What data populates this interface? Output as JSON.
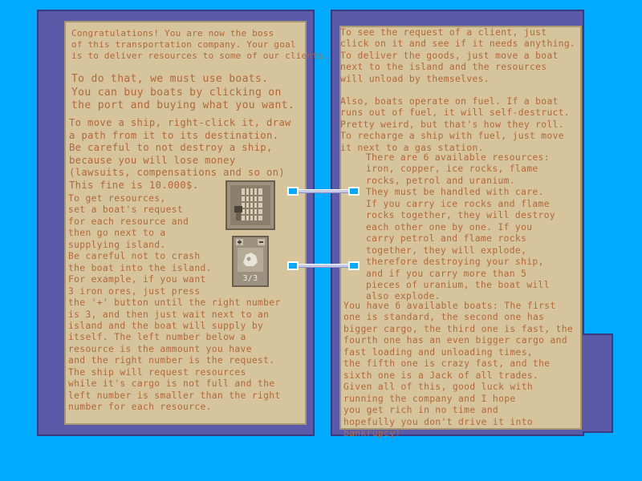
{
  "left_page": {
    "para1": "Congratulations! You are now the boss\nof this transportation company. Your goal\nis to deliver resources to some of our clients.",
    "para2": "To do that, we must use boats.\nYou can buy boats by clicking on\nthe port and buying what you want.",
    "para3": "To move a ship, right-click it, draw\na path from it to its destination.\nBe careful to not destroy a ship,\nbecause you will lose money\n(lawsuits, compensations and so on)\nThis fine is 10.000$.",
    "para4": "To get resources,\nset a boat's request\nfor each resource and\nthen go next to a\nsupplying island.\nBe careful not to crash\nthe boat into the island.\nFor example, if you want\n3 iron ores, just press\nthe '+' button until the right number\nis 3, and then just wait next to an\nisland and the boat will supply by\nitself. The left number below a\nresource is the ammount you have\nand the right number is the request.\nThe ship will request resources\nwhile it's cargo is not full and the\nleft number is smaller than the right\nnumber for each resource.",
    "ore_counter": "3/3"
  },
  "right_page": {
    "para1": "To see the request of a client, just\nclick on it and see if it needs anything.\nTo deliver the goods, just move a boat\nnext to the island and the resources\nwill unload by themselves.",
    "para2": "Also, boats operate on fuel. If a boat\nruns out of fuel, it will self-destruct.\nPretty weird, but that's how they roll.\nTo recharge a ship with fuel, just move\nit next to a gas station.",
    "para3": "There are 6 available resources:\niron, copper, ice rocks, flame\nrocks, petrol and uranium.\nThey must be handled with care.\nIf you carry ice rocks and flame\nrocks together, they will destroy\neach other one by one. If you\ncarry petrol and flame rocks\ntogether, they will explode,\ntherefore destroying your ship,\nand if you carry more than 5\npieces of uranium, the boat will\nalso explode.",
    "para4": "You have 6 available boats: The first\none is standard, the second one has\nbigger cargo, the third one is fast, the\nfourth one has an even bigger cargo and\nfast loading and unloading times,\nthe fifth one is crazy fast, and the\nsixth one is a Jack of all trades.\nGiven all of this, good luck with\nrunning the company and I hope\nyou get rich in no time and\nhopefully you don't drive it into\nbankrupcy!"
  },
  "icons": {
    "cargo_grid": "cargo-grid-icon",
    "ore_rock": "ore-rock-icon",
    "plus": "plus-icon",
    "minus": "minus-icon"
  },
  "colors": {
    "background": "#00aaff",
    "book_cover": "#5a5aa8",
    "paper": "#d5c49c",
    "text": "#b4673a"
  }
}
